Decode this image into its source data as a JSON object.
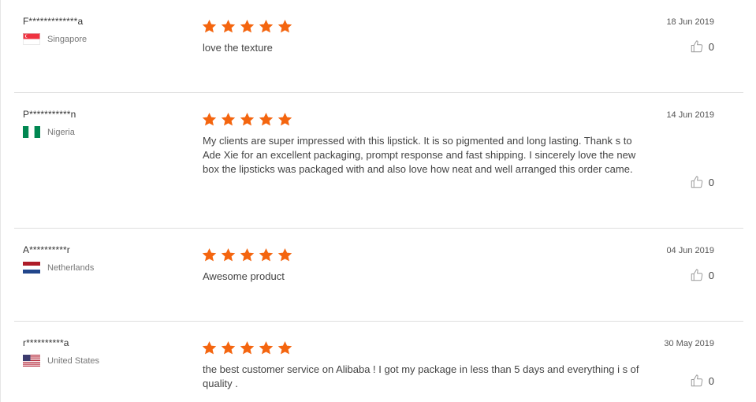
{
  "colors": {
    "star": "#f4650f",
    "divider": "#dedede",
    "like_icon": "#999999"
  },
  "icons": {
    "rating": "star-icon",
    "like": "thumbs-up-icon"
  },
  "reviews": [
    {
      "reviewer": "F*************a",
      "country": "Singapore",
      "flag": "flag-singapore",
      "rating": 5,
      "text": "love the texture",
      "date": "18 Jun 2019",
      "likes": "0"
    },
    {
      "reviewer": "P***********n",
      "country": "Nigeria",
      "flag": "flag-nigeria",
      "rating": 5,
      "text": "My clients are super impressed with this lipstick. It is so pigmented and long lasting. Thank s to Ade Xie for an excellent packaging, prompt response and fast shipping. I sincerely love the new box the lipsticks was packaged with and also love how neat and well arranged this order came.",
      "date": "14 Jun 2019",
      "likes": "0"
    },
    {
      "reviewer": "A**********r",
      "country": "Netherlands",
      "flag": "flag-netherlands",
      "rating": 5,
      "text": "Awesome product",
      "date": "04 Jun 2019",
      "likes": "0"
    },
    {
      "reviewer": "r**********a",
      "country": "United States",
      "flag": "flag-united-states",
      "rating": 5,
      "text": "the best customer service on Alibaba ! I got my package in less than 5 days and everything i s of quality .",
      "date": "30 May 2019",
      "likes": "0"
    }
  ]
}
